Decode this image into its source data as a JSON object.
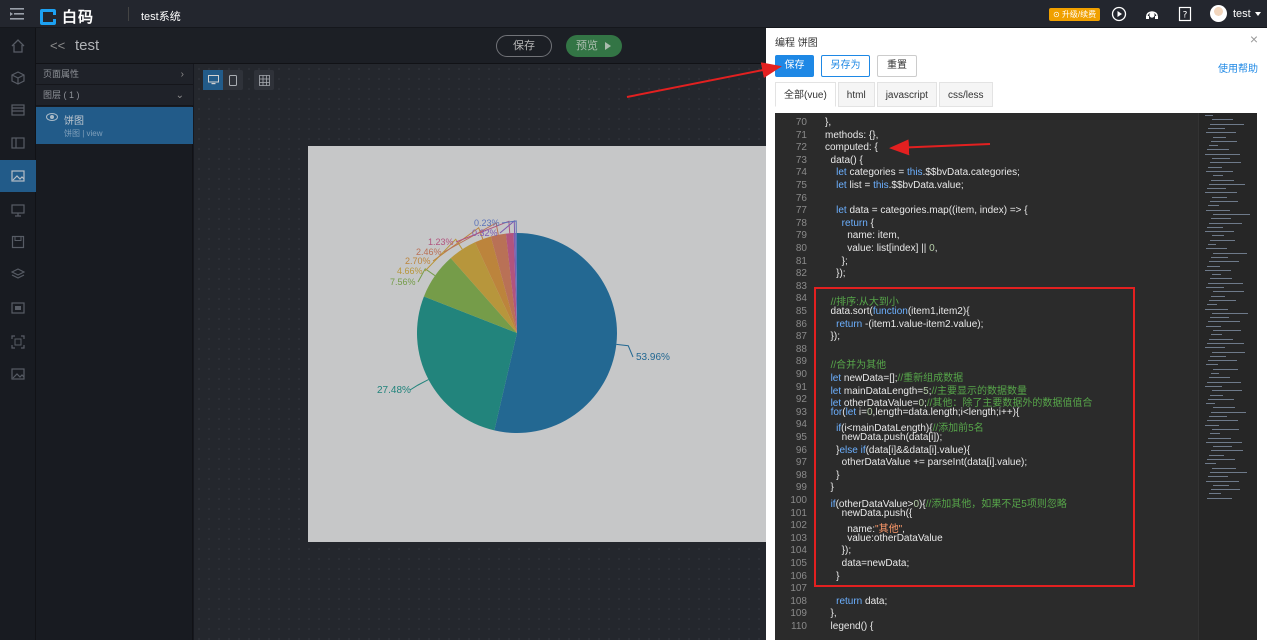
{
  "topbar": {
    "logo_text": "白码",
    "project_name": "test系统",
    "upgrade_label": "升级/续费",
    "username": "test"
  },
  "rail": {
    "icons": [
      "home-icon",
      "cube-icon",
      "list-icon",
      "layout-icon",
      "image-icon",
      "monitor-icon",
      "save-icon",
      "layers-icon",
      "window-icon",
      "frame-icon",
      "image-icon"
    ]
  },
  "page": {
    "back_label": "<<",
    "title": "test",
    "save_label": "保存",
    "preview_label": "预览"
  },
  "props": {
    "page_props_label": "页面属性",
    "layers_label": "图层 ( 1 )",
    "layer_name": "饼图",
    "layer_sub_a": "饼图",
    "layer_sub_b": "view"
  },
  "pie": {
    "labels": {
      "l0": "53.96%",
      "l1": "27.48%",
      "l2": "7.56%",
      "l3": "4.66%",
      "l4": "2.70%",
      "l5": "2.46%",
      "l6": "1.23%",
      "l7": "0.32%",
      "l8": "0.23%"
    },
    "colors": [
      "#2b7fb3",
      "#2aa198",
      "#8fbf5a",
      "#e0b84a",
      "#e6a24a",
      "#e28a6a",
      "#d9679a",
      "#9a6fd6",
      "#6f8be0"
    ],
    "values": [
      53.96,
      27.48,
      7.56,
      4.66,
      2.7,
      2.46,
      1.23,
      0.32,
      0.23
    ]
  },
  "modal": {
    "title": "编程 饼图",
    "save_label": "保存",
    "save_as_label": "另存为",
    "reset_label": "重置",
    "help_label": "使用帮助",
    "tabs": [
      "全部(vue)",
      "html",
      "javascript",
      "css/less"
    ]
  },
  "code": {
    "first_line": 70,
    "lines": [
      "},",
      "methods: {},",
      "computed: {",
      "  data() {",
      "    let categories = this.$$bvData.categories;",
      "    let list = this.$$bvData.value;",
      "",
      "    let data = categories.map((item, index) => {",
      "      return {",
      "        name: item,",
      "        value: list[index] || 0,",
      "      };",
      "    });",
      "",
      "  //排序:从大到小",
      "  data.sort(function(item1,item2){",
      "    return -(item1.value-item2.value);",
      "  });",
      "",
      "  //合并为其他",
      "  let newData=[];//重新组成数据",
      "  let mainDataLength=5;//主要显示的数据数量",
      "  let otherDataValue=0;//其他：除了主要数据外的数据值值合",
      "  for(let i=0,length=data.length;i<length;i++){",
      "    if(i<mainDataLength){//添加前5名",
      "      newData.push(data[i]);",
      "    }else if(data[i]&&data[i].value){",
      "      otherDataValue += parseInt(data[i].value);",
      "    }",
      "  }",
      "  if(otherDataValue>0){//添加其他，如果不足5项则忽略",
      "      newData.push({",
      "        name:\"其他\",",
      "        value:otherDataValue",
      "      });",
      "      data=newData;",
      "    }",
      "",
      "    return data;",
      "  },",
      "  legend() {"
    ]
  }
}
